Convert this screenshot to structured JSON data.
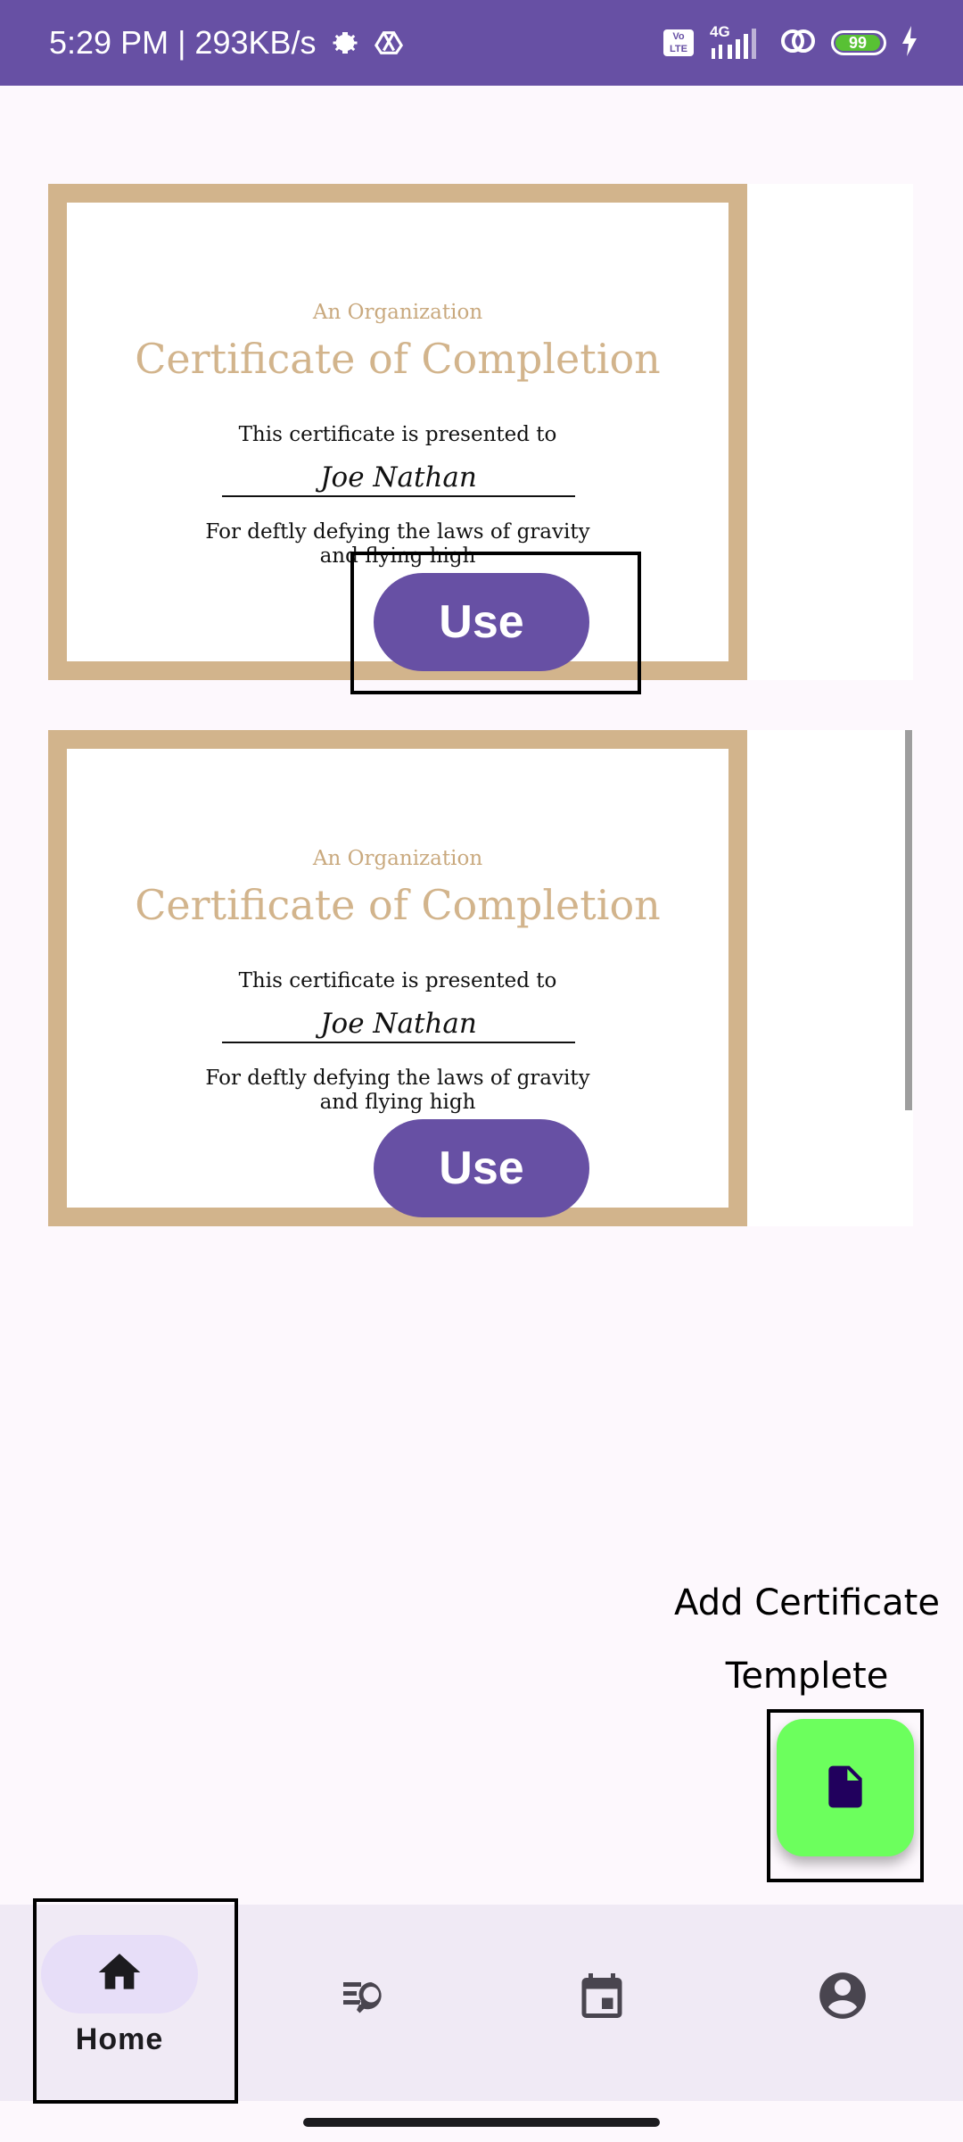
{
  "status_bar": {
    "time_speed": "5:29 PM | 293KB/s",
    "network": "4G",
    "volte": "Vo LTE",
    "battery": "99",
    "icons": [
      "settings-icon",
      "drive-icon",
      "signal-icon",
      "link-icon",
      "charging-icon"
    ]
  },
  "certificates": [
    {
      "organization": "An Organization",
      "title": "Certificate of Completion",
      "presented": "This certificate is presented to",
      "name": "Joe Nathan",
      "reason_line1": "For deftly defying the laws of gravity",
      "reason_line2": "and flying high",
      "use_label": "Use"
    },
    {
      "organization": "An Organization",
      "title": "Certificate of Completion",
      "presented": "This certificate is presented to",
      "name": "Joe Nathan",
      "reason_line1": "For deftly defying the laws of gravity",
      "reason_line2": "and flying high",
      "use_label": "Use"
    }
  ],
  "fab": {
    "label_line1": "Add Certificate",
    "label_line2": "Templete",
    "icon": "file-icon"
  },
  "nav": {
    "items": [
      {
        "label": "Home",
        "icon": "home-icon",
        "active": true
      },
      {
        "label": "",
        "icon": "search-list-icon",
        "active": false
      },
      {
        "label": "",
        "icon": "calendar-icon",
        "active": false
      },
      {
        "label": "",
        "icon": "account-icon",
        "active": false
      }
    ]
  },
  "colors": {
    "primary": "#6750a4",
    "certificate_border": "#d2b48c",
    "fab": "#6cff5d",
    "nav_background": "#f0eaf5"
  }
}
